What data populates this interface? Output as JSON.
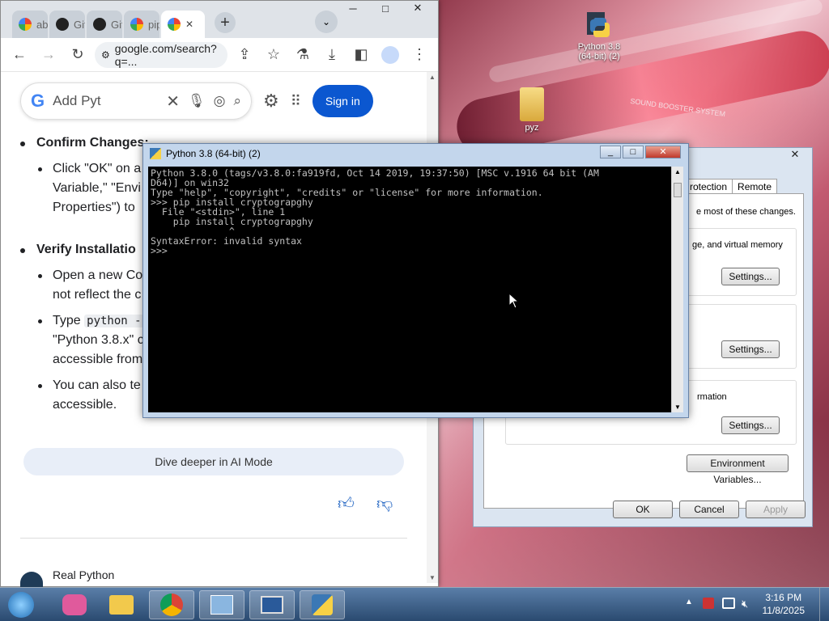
{
  "desktop": {
    "icons": [
      {
        "label": "Python 3.8 (64-bit) (2)",
        "icon": "python-shortcut-icon"
      },
      {
        "label": "pyz",
        "icon": "folder-icon"
      }
    ],
    "wallpaper_text": "SOUND BOOSTER SYSTEM"
  },
  "chrome": {
    "tabs": [
      {
        "label": "abi",
        "icon": "google-icon"
      },
      {
        "label": "Git",
        "icon": "github-icon"
      },
      {
        "label": "Git",
        "icon": "github-icon"
      },
      {
        "label": "pip",
        "icon": "google-icon"
      },
      {
        "label": "",
        "icon": "google-icon",
        "close": "✕"
      }
    ],
    "url": "google.com/search?q=...",
    "search_query": "Add Pyt",
    "sign_in": "Sign in",
    "content": {
      "confirm_heading": "Confirm Changes:",
      "confirm_lines": [
        "Click \"OK\" on a",
        "Variable,\" \"Envi",
        "Properties\") to"
      ],
      "verify_heading": "Verify Installatio",
      "open_lines": [
        "Open a new Co",
        "not reflect the c"
      ],
      "type_prefix": "Type ",
      "type_code": "python -",
      "type_lines": [
        "\"Python 3.8.x\" c",
        "accessible from"
      ],
      "also_lines": [
        "You can also te",
        "accessible."
      ]
    },
    "dive_deeper": "Dive deeper in AI Mode",
    "source": "Real Python"
  },
  "console": {
    "title": "Python 3.8 (64-bit) (2)",
    "lines": [
      "Python 3.8.0 (tags/v3.8.0:fa919fd, Oct 14 2019, 19:37:50) [MSC v.1916 64 bit (AM",
      "D64)] on win32",
      "Type \"help\", \"copyright\", \"credits\" or \"license\" for more information.",
      ">>> pip install cryptograpghy",
      "  File \"<stdin>\", line 1",
      "    pip install cryptograpghy",
      "              ^",
      "SyntaxError: invalid syntax",
      ">>> "
    ]
  },
  "sysprops": {
    "tabs": [
      "rotection",
      "Remote"
    ],
    "text1": "e most of these changes.",
    "text2": "ge, and virtual memory",
    "text3": "rmation",
    "settings": "Settings...",
    "env_vars": "Environment Variables...",
    "ok": "OK",
    "cancel": "Cancel",
    "apply": "Apply",
    "close": "✕"
  },
  "taskbar": {
    "time": "3:16 PM",
    "date": "11/8/2025"
  }
}
